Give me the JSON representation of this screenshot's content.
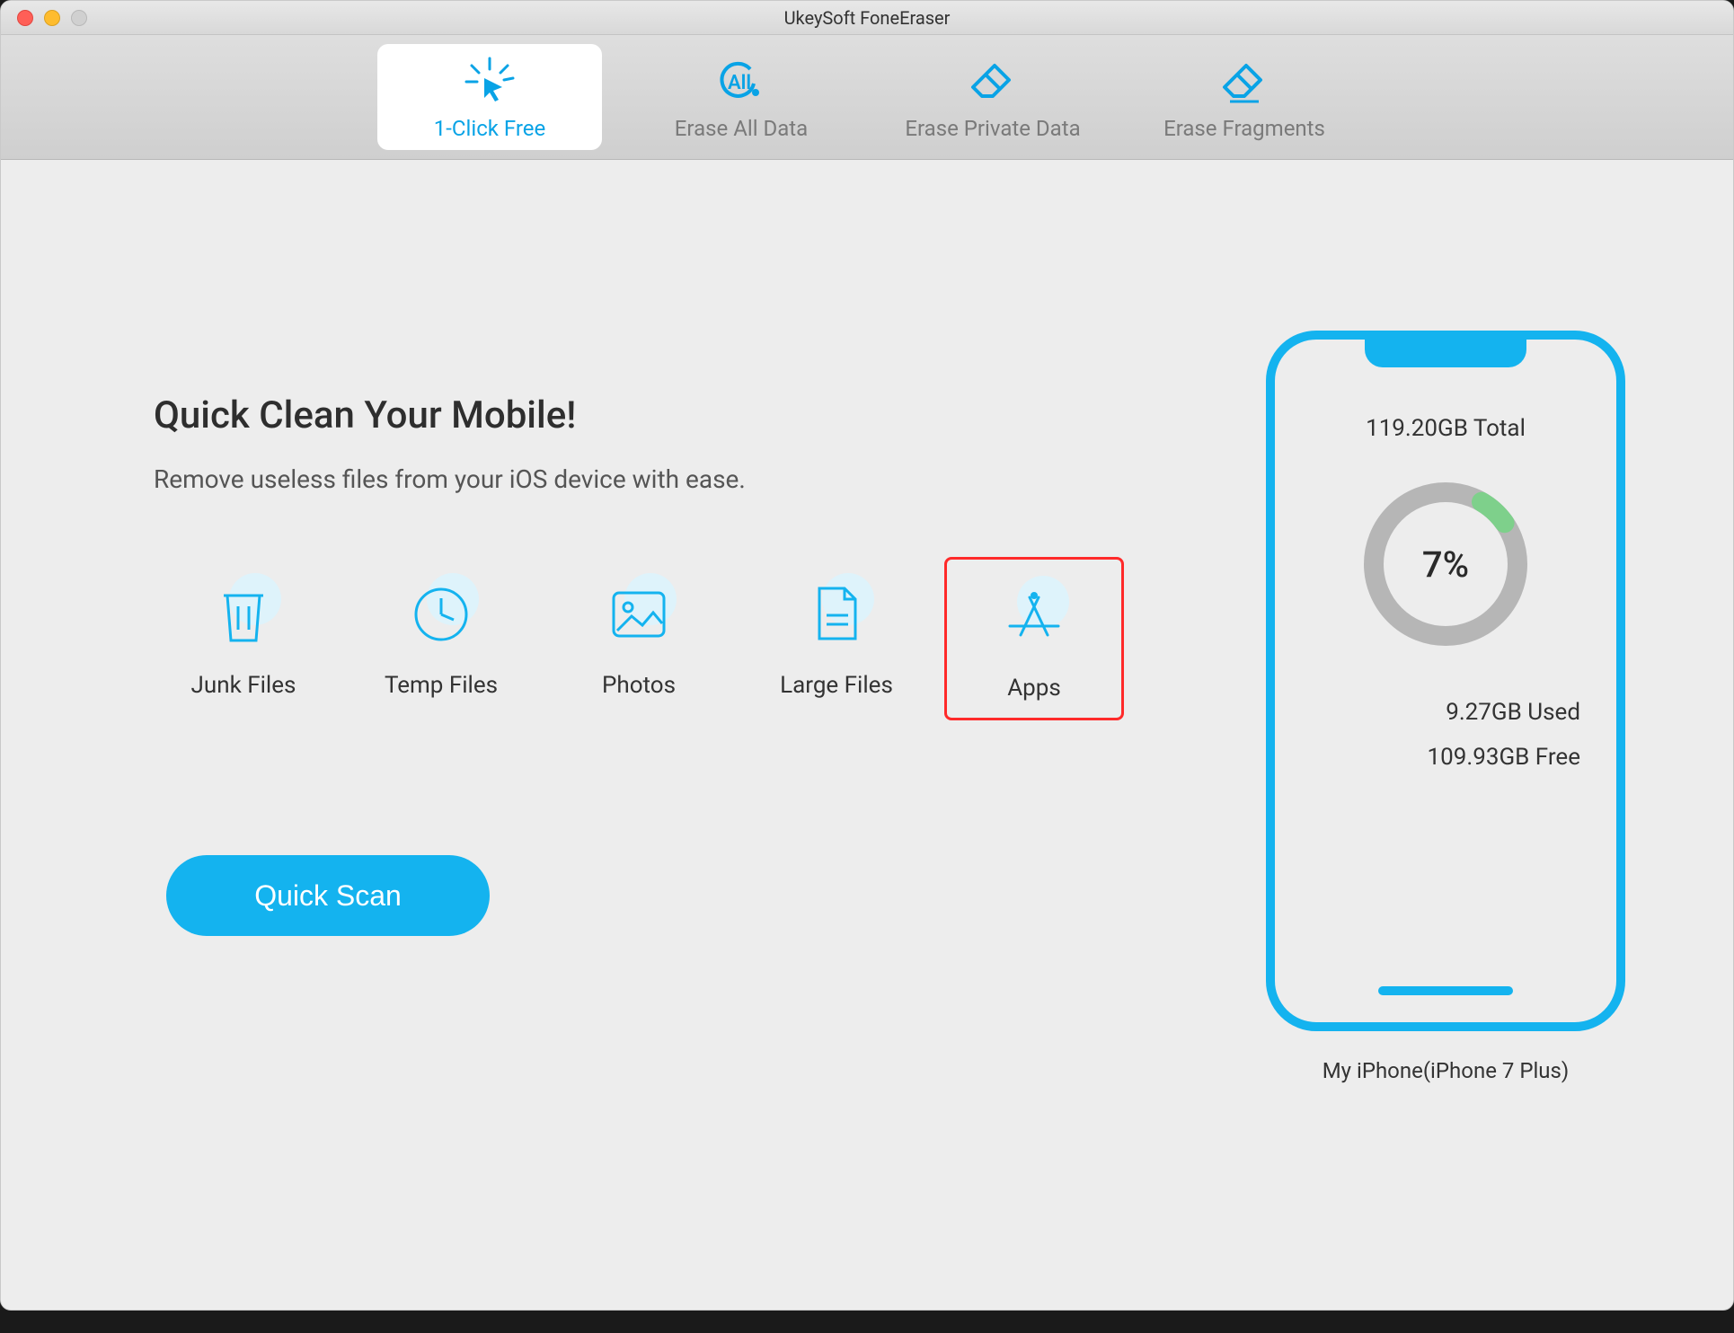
{
  "window": {
    "title": "UkeySoft FoneEraser"
  },
  "tabs": [
    {
      "label": "1-Click Free"
    },
    {
      "label": "Erase All Data"
    },
    {
      "label": "Erase Private Data"
    },
    {
      "label": "Erase Fragments"
    }
  ],
  "main": {
    "heading": "Quick Clean Your Mobile!",
    "subheading": "Remove useless files from your iOS device with ease.",
    "categories": [
      {
        "label": "Junk Files"
      },
      {
        "label": "Temp Files"
      },
      {
        "label": "Photos"
      },
      {
        "label": "Large Files"
      },
      {
        "label": "Apps"
      }
    ],
    "quick_scan_label": "Quick Scan"
  },
  "device": {
    "total": "119.20GB Total",
    "percent": "7%",
    "used": "9.27GB Used",
    "free": "109.93GB Free",
    "name": "My iPhone(iPhone 7 Plus)"
  },
  "chart_data": {
    "type": "pie",
    "title": "Storage Usage",
    "series": [
      {
        "name": "Used",
        "value": 9.27,
        "unit": "GB"
      },
      {
        "name": "Free",
        "value": 109.93,
        "unit": "GB"
      }
    ],
    "total_gb": 119.2,
    "percent_used": 7
  },
  "colors": {
    "accent": "#14b3ef",
    "highlight": "#ff2a2a",
    "ring_bg": "#b6b6b6",
    "ring_fg": "#7ed08b"
  }
}
